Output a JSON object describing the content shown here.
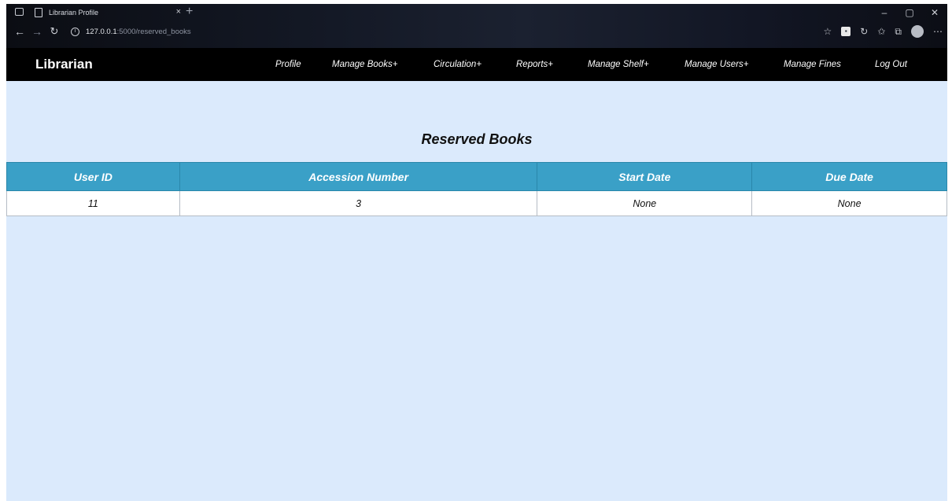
{
  "browser": {
    "tab_title": "Librarian Profile",
    "tab_close": "×",
    "new_tab": "+",
    "url_host": "127.0.0.1",
    "url_path": ":5000/reserved_books",
    "window_controls": [
      "–",
      "▢",
      "✕"
    ]
  },
  "nav": {
    "brand": "Librarian",
    "links": [
      "Profile",
      "Manage Books+",
      "Circulation+",
      "Reports+",
      "Manage Shelf+",
      "Manage Users+",
      "Manage Fines",
      "Log Out"
    ]
  },
  "main": {
    "title": "Reserved Books",
    "table": {
      "columns": [
        "User ID",
        "Accession Number",
        "Start Date",
        "Due Date"
      ],
      "rows": [
        [
          "11",
          "3",
          "None",
          "None"
        ]
      ]
    }
  },
  "colors": {
    "header_bg": "#3aa0c7",
    "page_bg": "#dbeafc",
    "nav_bg": "#000000"
  },
  "icons": [
    "window-icon",
    "page-icon",
    "back-arrow-icon",
    "forward-arrow-icon",
    "reload-icon",
    "info-icon",
    "favorite-icon",
    "extension-icon",
    "refresh-icon",
    "favorites-icon",
    "collections-icon",
    "profile-icon",
    "more-icon"
  ]
}
